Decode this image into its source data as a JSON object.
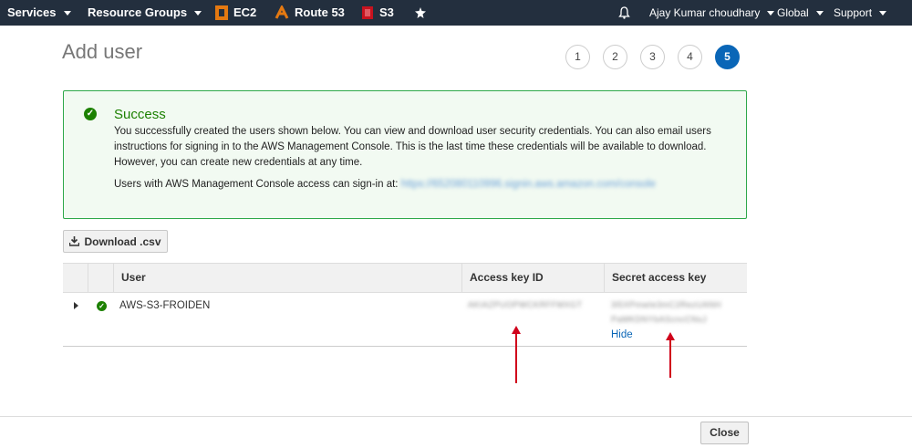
{
  "nav": {
    "services": "Services",
    "resource_groups": "Resource Groups",
    "ec2": "EC2",
    "route53": "Route 53",
    "s3": "S3",
    "pin_icon": "pin-icon",
    "bell_icon": "bell-icon",
    "user": "Ajay Kumar choudhary",
    "region": "Global",
    "support": "Support"
  },
  "page": {
    "title": "Add user"
  },
  "steps": [
    "1",
    "2",
    "3",
    "4",
    "5"
  ],
  "success": {
    "title": "Success",
    "text": "You successfully created the users shown below. You can view and download user security credentials. You can also email users instructions for signing in to the AWS Management Console. This is the last time these credentials will be available to download. However, you can create new credentials at any time.",
    "signin_label": "Users with AWS Management Console access can sign-in at:",
    "signin_url": "https://652080110996.signin.aws.amazon.com/console"
  },
  "download": {
    "label": "Download .csv"
  },
  "table": {
    "headers": [
      "User",
      "Access key ID",
      "Secret access key"
    ],
    "rows": [
      {
        "user": "AWS-S3-FROIDEN",
        "access_key": "AKIAZPUOPWCKRFFMXGT",
        "secret_line1": "3l5XPmwIe3mC2RezUANH",
        "secret_line2": "PaMKDNYbAScncCNsJ",
        "hide": "Hide"
      }
    ]
  },
  "footer": {
    "close": "Close"
  },
  "colors": {
    "nav_bg": "#232f3e",
    "success": "#1d8102",
    "link": "#0a66b7",
    "arrow": "#d0021b"
  }
}
